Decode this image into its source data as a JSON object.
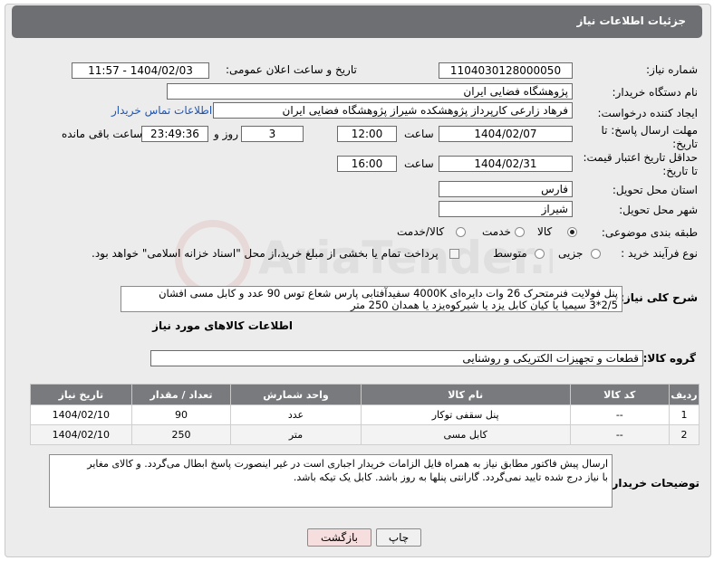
{
  "header": {
    "title": "جزئیات اطلاعات نیاز"
  },
  "fields": {
    "need_number_label": "شماره نیاز:",
    "need_number": "1104030128000050",
    "announce_label": "تاریخ و ساعت اعلان عمومی:",
    "announce_value": "1404/02/03 - 11:57",
    "buyer_org_label": "نام دستگاه خریدار:",
    "buyer_org": "پژوهشگاه فضایی ایران",
    "creator_label": "ایجاد کننده درخواست:",
    "creator": "فرهاد زارعی کارپرداز پژوهشکده شیراز پژوهشگاه فضایی ایران",
    "contact_link": "اطلاعات تماس خریدار",
    "deadline_label_1": "مهلت ارسال پاسخ: تا",
    "deadline_label_2": "تاریخ:",
    "deadline_date": "1404/02/07",
    "time_label": "ساعت",
    "deadline_time": "12:00",
    "days_value": "3",
    "days_label": "روز و",
    "remaining_value": "23:49:36",
    "remaining_label": "ساعت باقی مانده",
    "price_label_1": "حداقل تاریخ اعتبار قیمت:",
    "price_label_2": "تا تاریخ:",
    "price_date": "1404/02/31",
    "price_time": "16:00",
    "province_label": "استان محل تحویل:",
    "province": "فارس",
    "city_label": "شهر محل تحویل:",
    "city": "شیراز",
    "category_label": "طبقه بندی موضوعی:",
    "category_options": [
      "کالا",
      "خدمت",
      "کالا/خدمت"
    ],
    "process_label": "نوع فرآیند خرید :",
    "process_options": [
      "جزیی",
      "متوسط"
    ],
    "payment_note": "پرداخت تمام یا بخشی از مبلغ خرید،از محل \"اسناد خزانه اسلامی\" خواهد بود.",
    "summary_label": "شرح کلی نیاز:",
    "summary_line1": "پنل فولایت فنرمتحرک 26 وات دایره‌ای 4000K سفیدآفتابی پارس شعاع توس 90 عدد و کابل مسی افشان",
    "summary_line2": "2/5*3 سیمیا یا کیان کابل یزد یا شیرکوه‌یزد یا همدان 250 متر"
  },
  "goods": {
    "section_title": "اطلاعات کالاهای مورد نیاز",
    "group_label": "گروه کالا:",
    "group_value": "قطعات و تجهیزات الکتریکی و روشنایی",
    "columns": [
      "ردیف",
      "کد کالا",
      "نام کالا",
      "واحد شمارش",
      "تعداد / مقدار",
      "تاریخ نیاز"
    ],
    "rows": [
      [
        "1",
        "--",
        "پنل سقفی توکار",
        "عدد",
        "90",
        "1404/02/10"
      ],
      [
        "2",
        "--",
        "کابل مسی",
        "متر",
        "250",
        "1404/02/10"
      ]
    ]
  },
  "notes": {
    "label": "توضیحات خریدار:",
    "line1": "ارسال پیش فاکتور مطابق نیاز به همراه فایل الزامات خریدار اجباری است در غیر اینصورت پاسخ ابطال می‌گردد. و کالای مغایر",
    "line2": "با نیاز درج شده تایید نمی‌گردد. گارانتی پنلها به روز باشد. کابل یک تیکه باشد."
  },
  "buttons": {
    "print": "چاپ",
    "back": "بازگشت"
  },
  "watermark": {
    "text": "AriaTender.net"
  },
  "colors": {
    "title_bar": "#6d6f72",
    "table_header": "#787a7d",
    "link": "#1e56b8"
  }
}
